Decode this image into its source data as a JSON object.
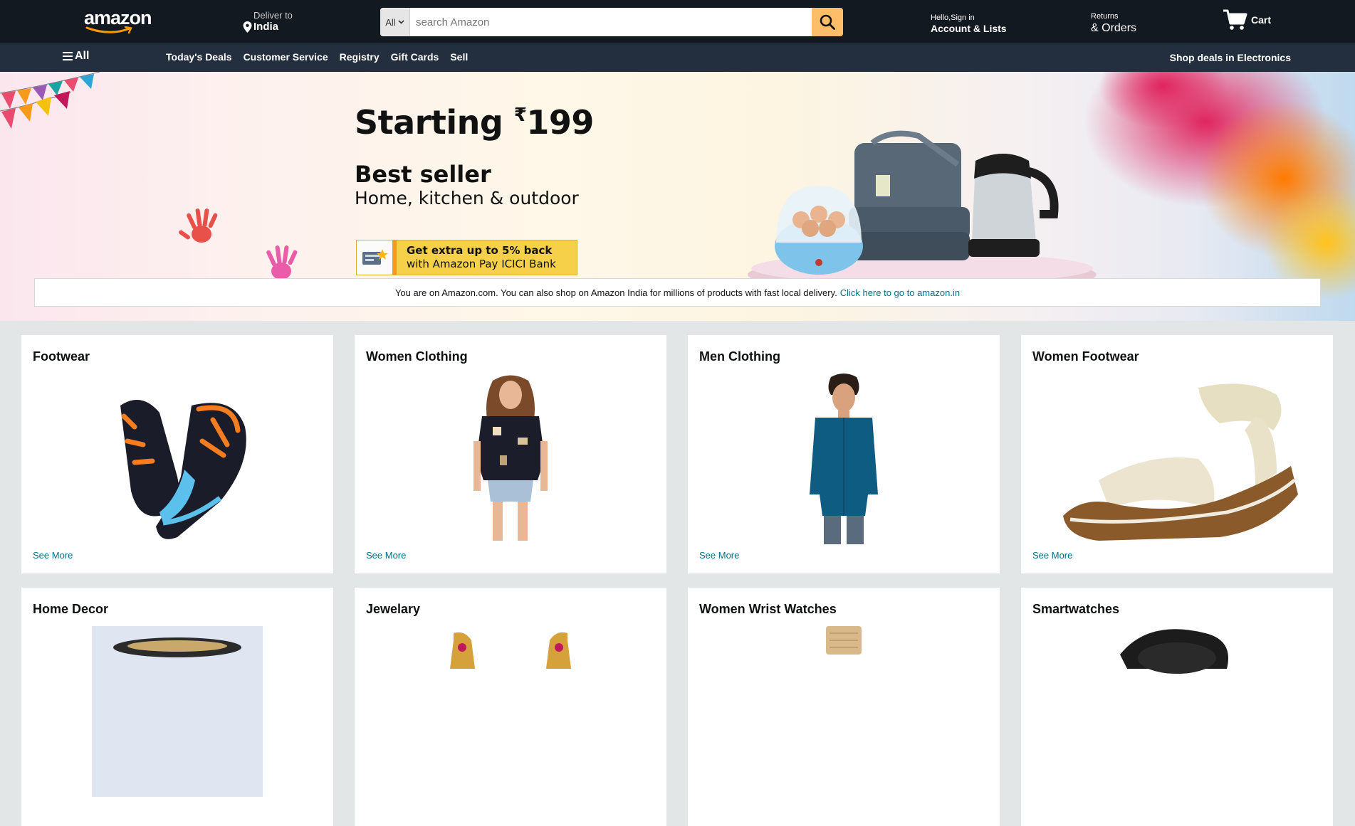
{
  "header": {
    "logo": "amazon",
    "deliver_label": "Deliver to",
    "deliver_location": "India",
    "search_category": "All",
    "search_placeholder": "search Amazon",
    "account_greeting": "Hello,Sign in",
    "account_label": "Account & Lists",
    "returns_label": "Returns",
    "orders_label": "& Orders",
    "cart_label": "Cart"
  },
  "subnav": {
    "all_label": "All",
    "links": [
      "Today's Deals",
      "Customer Service",
      "Registry",
      "Gift Cards",
      "Sell"
    ],
    "promo": "Shop deals in Electronics"
  },
  "hero": {
    "title_prefix": "Starting",
    "currency": "₹",
    "price": "199",
    "subtitle": "Best seller",
    "tagline": "Home, kitchen & outdoor",
    "offer_line1": "Get extra up to 5% back",
    "offer_line2": "with Amazon Pay ICICI Bank",
    "notice_text": "You are on Amazon.com. You can also shop on Amazon India for millions of products with fast local delivery.",
    "notice_link": "Click here to go to amazon.in"
  },
  "cards": [
    {
      "title": "Footwear",
      "link": "See More",
      "image": "shoe-image"
    },
    {
      "title": "Women Clothing",
      "link": "See More",
      "image": "woman-model-image"
    },
    {
      "title": "Men Clothing",
      "link": "See More",
      "image": "man-model-image"
    },
    {
      "title": "Women Footwear",
      "link": "See More",
      "image": "sandal-image"
    },
    {
      "title": "Home Decor",
      "link": "",
      "image": "home-decor-image"
    },
    {
      "title": "Jewelary",
      "link": "",
      "image": "earrings-image"
    },
    {
      "title": "Women Wrist Watches",
      "link": "",
      "image": "wrist-watch-image"
    },
    {
      "title": "Smartwatches",
      "link": "",
      "image": "smartwatch-image"
    }
  ],
  "colors": {
    "nav_dark": "#131921",
    "subnav": "#232f3e",
    "search_button": "#febd69",
    "link": "#007185"
  }
}
